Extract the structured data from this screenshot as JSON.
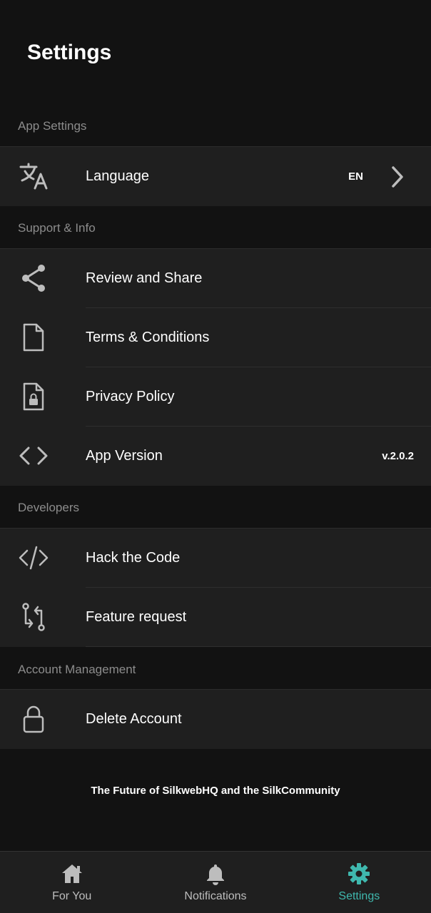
{
  "header": {
    "title": "Settings"
  },
  "sections": {
    "app_settings": {
      "title": "App Settings",
      "language": {
        "label": "Language",
        "value": "EN"
      }
    },
    "support_info": {
      "title": "Support & Info",
      "review": {
        "label": "Review and Share"
      },
      "terms": {
        "label": "Terms & Conditions"
      },
      "privacy": {
        "label": "Privacy Policy"
      },
      "version": {
        "label": "App Version",
        "value": "v.2.0.2"
      }
    },
    "developers": {
      "title": "Developers",
      "hack": {
        "label": "Hack the Code"
      },
      "feature": {
        "label": "Feature request"
      }
    },
    "account": {
      "title": "Account Management",
      "delete": {
        "label": "Delete Account"
      }
    }
  },
  "footer": {
    "text": "The Future of SilkwebHQ and the SilkCommunity"
  },
  "nav": {
    "for_you": "For You",
    "notifications": "Notifications",
    "settings": "Settings",
    "active_color": "#3fb8ae"
  }
}
